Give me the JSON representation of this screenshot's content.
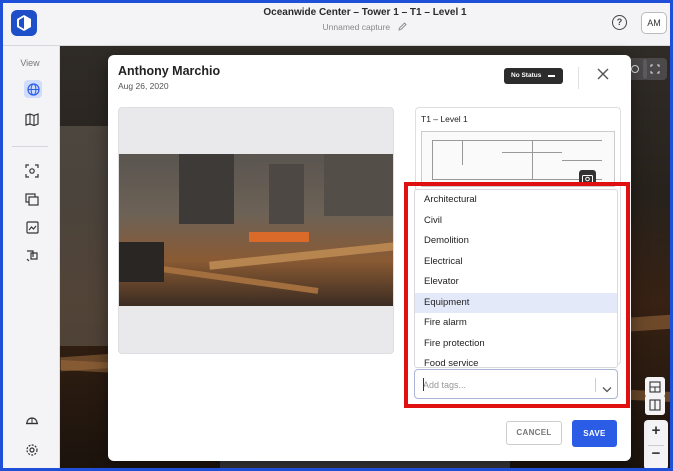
{
  "header": {
    "title": "Oceanwide Center – Tower 1 – T1 – Level 1",
    "subtitle": "Unnamed capture",
    "help_icon": "question-circle-icon",
    "avatar_initials": "AM"
  },
  "sidebar": {
    "label": "View",
    "items": [
      {
        "icon": "globe-icon",
        "active": true
      },
      {
        "icon": "map-icon"
      },
      {
        "icon": "capture-focus-icon"
      },
      {
        "icon": "layers-icon"
      },
      {
        "icon": "image-icon"
      },
      {
        "icon": "compare-icon"
      },
      {
        "icon": "hardhat-icon"
      },
      {
        "icon": "gear-icon"
      }
    ]
  },
  "modal": {
    "author": "Anthony Marchio",
    "date": "Aug 26, 2020",
    "status_label": "No Status",
    "map_title": "T1 – Level 1",
    "tags": [
      "Architectural",
      "Civil",
      "Demolition",
      "Electrical",
      "Elevator",
      "Equipment",
      "Fire alarm",
      "Fire protection",
      "Food service"
    ],
    "highlighted_tag": "Equipment",
    "tag_input_placeholder": "Add tags...",
    "cancel_label": "CANCEL",
    "save_label": "SAVE"
  },
  "colors": {
    "accent": "#2b5ce6",
    "brand": "#1e4fc8",
    "highlight_box": "#e01010",
    "list_highlight": "#e4e9fa"
  }
}
